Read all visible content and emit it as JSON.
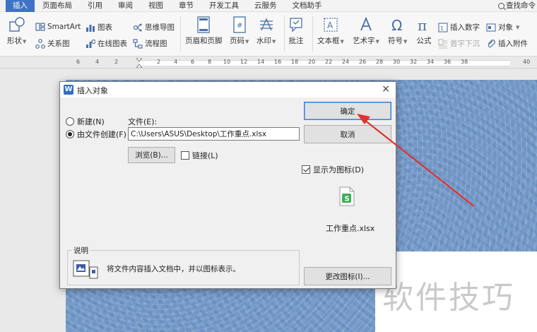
{
  "menu": {
    "items": [
      "插入",
      "页面布局",
      "引用",
      "审阅",
      "视图",
      "章节",
      "开发工具",
      "云服务",
      "文档助手"
    ],
    "search_label": "查找命令"
  },
  "ribbon": {
    "shapes_label": "形状",
    "smartart_label": "SmartArt",
    "chart_label": "图表",
    "mindmap_label": "思维导图",
    "relation_label": "关系图",
    "online_chart_label": "在线图表",
    "flowchart_label": "流程图",
    "header_footer_label": "页眉和页脚",
    "page_number_label": "页码",
    "watermark_label": "水印",
    "comment_label": "批注",
    "textbox_label": "文本框",
    "wordart_label": "艺术字",
    "symbol_label": "符号",
    "formula_label": "公式",
    "insert_number_label": "插入数字",
    "object_label": "对象",
    "dropcap_label": "首字下沉",
    "attachment_label": "插入附件"
  },
  "ruler": {
    "numbers": [
      "6",
      "4",
      "2",
      "2",
      "4",
      "6",
      "8",
      "10",
      "12",
      "14",
      "16",
      "18",
      "20",
      "22",
      "24",
      "26",
      "28",
      "30",
      "32",
      "34",
      "36",
      "38",
      "40"
    ]
  },
  "dialog": {
    "title": "插入对象",
    "close_symbol": "×",
    "radio_new": "新建(N)",
    "radio_from_file": "由文件创建(F)",
    "file_label": "文件(E):",
    "file_path": "C:\\Users\\ASUS\\Desktop\\工作重点.xlsx",
    "browse_button": "浏览(B)...",
    "link_label": "链接(L)",
    "ok_button": "确定",
    "cancel_button": "取消",
    "display_as_icon_label": "显示为图标(D)",
    "icon_caption": "工作重点.xlsx",
    "icon_glyph": "S",
    "description_title": "说明",
    "description_text": "将文件内容插入文档中，并以图标表示。",
    "change_icon_button": "更改图标(I)..."
  },
  "watermark": {
    "text": "软件技巧"
  },
  "colors": {
    "accent": "#3f73c5",
    "arrow": "#e0322e",
    "page_bg": "#6f96c6",
    "sheet_icon": "#3fae5a"
  }
}
